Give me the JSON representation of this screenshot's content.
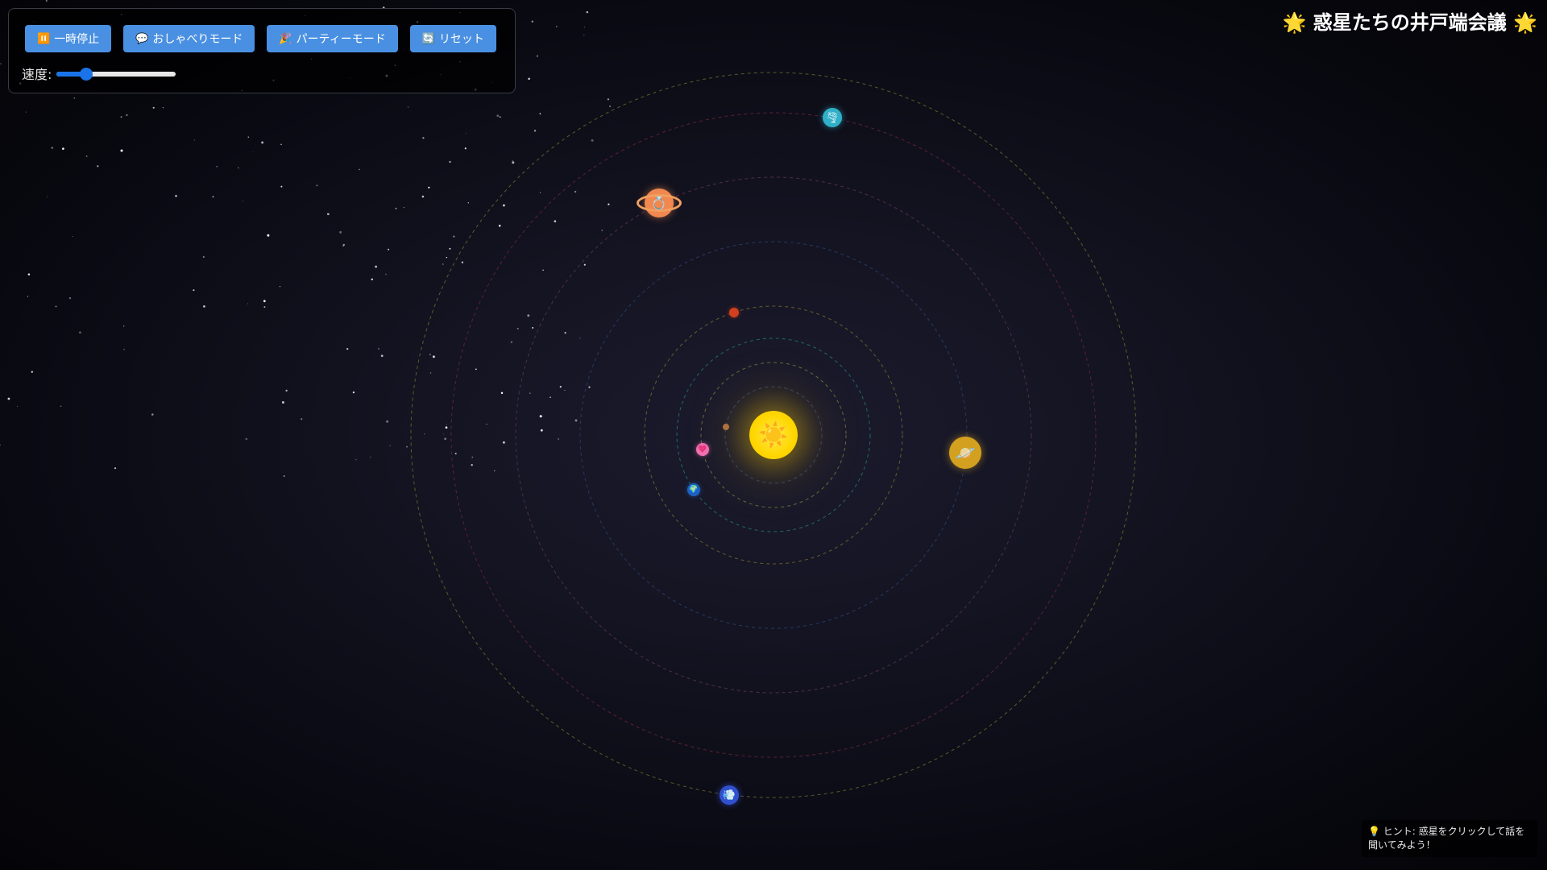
{
  "app": {
    "title": "🌟 惑星たちの井戸端会議 🌟"
  },
  "controls": {
    "buttons": [
      {
        "icon": "⏸️",
        "label": "一時停止"
      },
      {
        "icon": "💬",
        "label": "おしゃべりモード"
      },
      {
        "icon": "🎉",
        "label": "パーティーモード"
      },
      {
        "icon": "🔄",
        "label": "リセット"
      }
    ],
    "speed_label": "速度:",
    "speed_value": 0.25
  },
  "hint": "💡 ヒント: 惑星をクリックして話を聞いてみよう！",
  "sun": {
    "icon": "☀️",
    "color": "#ffd600"
  },
  "planets": [
    {
      "id": "mercury",
      "icon": "●",
      "color": "#b07040"
    },
    {
      "id": "venus",
      "icon": "💗",
      "color": "#f070b0"
    },
    {
      "id": "earth",
      "icon": "🌍",
      "color": "#2060c0"
    },
    {
      "id": "mars",
      "icon": "●",
      "color": "#d04020"
    },
    {
      "id": "jupiter",
      "icon": "🪐",
      "color": "#d4a020"
    },
    {
      "id": "saturn",
      "icon": "💍",
      "color": "#f08850"
    },
    {
      "id": "uranus",
      "icon": "🌪",
      "color": "#30b0c8"
    },
    {
      "id": "neptune",
      "icon": "💨",
      "color": "#3050d0"
    }
  ]
}
